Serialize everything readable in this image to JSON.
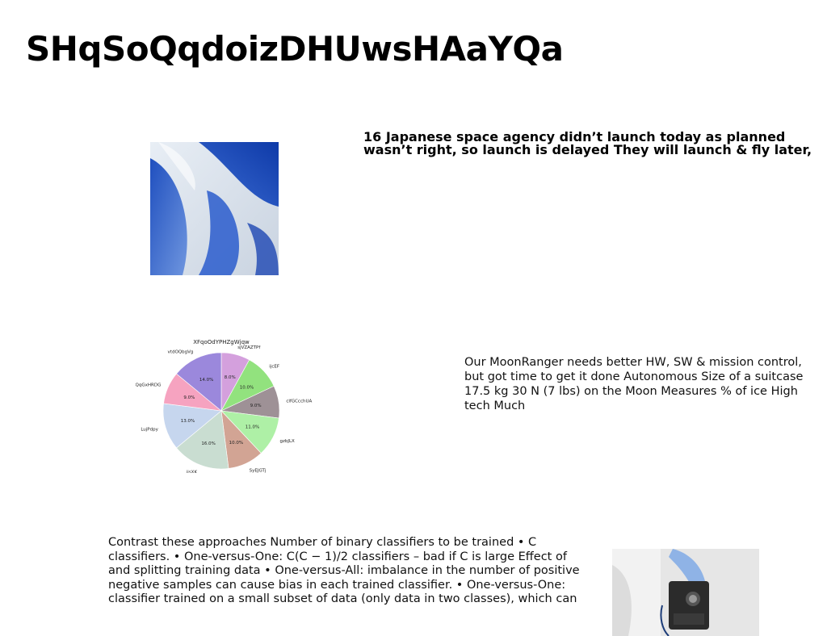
{
  "slide": {
    "title": "SHqSoQqdoizDHUwsHAaYQa",
    "paragraph_launch": "16 Japanese space agency didn’t launch today as planned wasn’t right, so launch is delayed They will launch & fly later,",
    "paragraph_moonranger": "Our MoonRanger needs better HW, SW & mission control, but got time to get it done Autonomous Size of a suitcase 17.5 kg 30 N (7 lbs) on the Moon Measures % of ice High tech Much",
    "paragraph_classifiers": "Contrast these approaches Number of binary classifiers to be trained • C classifiers. • One-versus-One: C(C − 1)/2 classifiers – bad if C is large Effect of and splitting training data • One-versus-All: imbalance in the number of positive negative samples can cause bias in each trained classifier. • One-versus-One: classifier trained on a small subset of data (only data in two classes), which can"
  },
  "chart_data": {
    "type": "pie",
    "title": "XFqoOdYPHZgWjqw",
    "categories": [
      "sjVZAZTPf",
      "ijcEF",
      "clfGCcchUA",
      "gzbJLX",
      "SyEJGTj",
      "iisXK",
      "LujPdpy",
      "pUQqGxHRDG",
      "vtdOQbgVg"
    ],
    "values": [
      8.0,
      10.0,
      9.0,
      11.0,
      10.0,
      16.0,
      13.0,
      9.0,
      14.0
    ],
    "value_labels": [
      "8.0%",
      "10.0%",
      "9.0%",
      "11.0%",
      "10.0%",
      "16.0%",
      "13.0%",
      "9.0%",
      "14.0%"
    ],
    "colors": [
      "#d4a0dd",
      "#92e27e",
      "#9e9196",
      "#aef0a6",
      "#d2a494",
      "#c9ddd1",
      "#c6d6ee",
      "#f6a3c0",
      "#9b88dc"
    ],
    "start": "top",
    "direction": "clockwise"
  }
}
